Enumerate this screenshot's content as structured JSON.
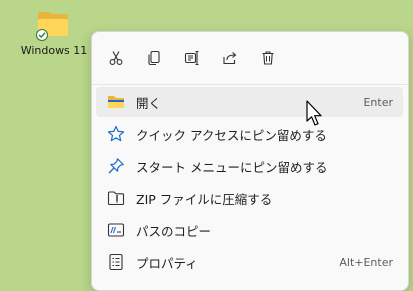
{
  "desktop": {
    "icon_label": "Windows 11",
    "icon": "folder-icon",
    "badge": "sync-checkmark-icon"
  },
  "toolbar": {
    "buttons": [
      {
        "name": "cut",
        "icon": "scissors-icon"
      },
      {
        "name": "copy",
        "icon": "copy-icon"
      },
      {
        "name": "rename",
        "icon": "rename-icon"
      },
      {
        "name": "share",
        "icon": "share-icon"
      },
      {
        "name": "delete",
        "icon": "trash-icon"
      }
    ]
  },
  "menu": {
    "items": [
      {
        "label": "開く",
        "shortcut": "Enter",
        "icon": "folder-icon"
      },
      {
        "label": "クイック アクセスにピン留めする",
        "shortcut": "",
        "icon": "star-icon"
      },
      {
        "label": "スタート メニューにピン留めする",
        "shortcut": "",
        "icon": "pin-icon"
      },
      {
        "label": "ZIP ファイルに圧縮する",
        "shortcut": "",
        "icon": "zip-folder-icon"
      },
      {
        "label": "パスのコピー",
        "shortcut": "",
        "icon": "copy-path-icon"
      },
      {
        "label": "プロパティ",
        "shortcut": "Alt+Enter",
        "icon": "properties-icon"
      }
    ]
  },
  "colors": {
    "desktop_bg": "#b9d68a",
    "menu_bg": "#f9f9f9",
    "accent_blue": "#1b6ac9",
    "folder_yellow": "#ffd55a"
  }
}
